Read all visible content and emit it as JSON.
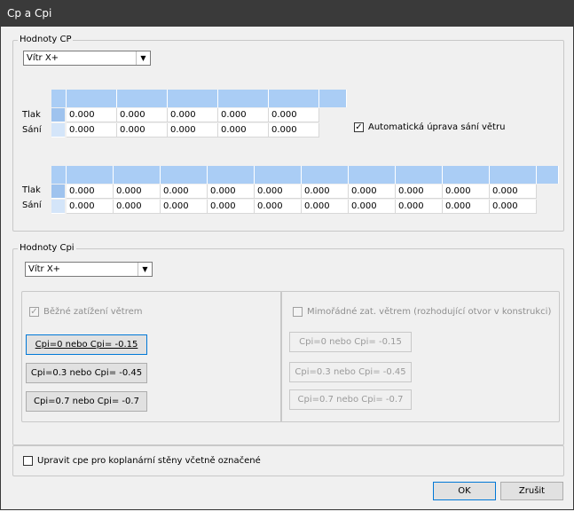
{
  "window": {
    "title": "Cp a Cpi"
  },
  "cp_group": {
    "legend": "Hodnoty CP",
    "select_value": "Vítr X+",
    "table1": {
      "rows": [
        {
          "label": "Tlak",
          "values": [
            "0.000",
            "0.000",
            "0.000",
            "0.000",
            "0.000"
          ]
        },
        {
          "label": "Sání",
          "values": [
            "0.000",
            "0.000",
            "0.000",
            "0.000",
            "0.000"
          ]
        }
      ]
    },
    "auto_checkbox_label": "Automatická úprava sání větru",
    "table2": {
      "rows": [
        {
          "label": "Tlak",
          "values": [
            "0.000",
            "0.000",
            "0.000",
            "0.000",
            "0.000",
            "0.000",
            "0.000",
            "0.000",
            "0.000",
            "0.000"
          ]
        },
        {
          "label": "Sání",
          "values": [
            "0.000",
            "0.000",
            "0.000",
            "0.000",
            "0.000",
            "0.000",
            "0.000",
            "0.000",
            "0.000",
            "0.000"
          ]
        }
      ]
    }
  },
  "cpi_group": {
    "legend": "Hodnoty Cpi",
    "select_value": "Vítr X+",
    "normal": {
      "checkbox_label": "Běžné zatížení větrem",
      "buttons": [
        "Cpi=0 nebo Cpi= -0.15",
        "Cpi=0.3 nebo Cpi= -0.45",
        "Cpi=0.7 nebo Cpi= -0.7"
      ]
    },
    "extraordinary": {
      "checkbox_label": "Mimořádné zat. větrem (rozhodující otvor v konstrukci)",
      "buttons": [
        "Cpi=0 nebo Cpi= -0.15",
        "Cpi=0.3 nebo Cpi= -0.45",
        "Cpi=0.7 nebo Cpi= -0.7"
      ]
    }
  },
  "coplanar_checkbox_label": "Upravit cpe pro koplanární stěny včetně označené",
  "footer": {
    "ok": "OK",
    "cancel": "Zrušit"
  }
}
